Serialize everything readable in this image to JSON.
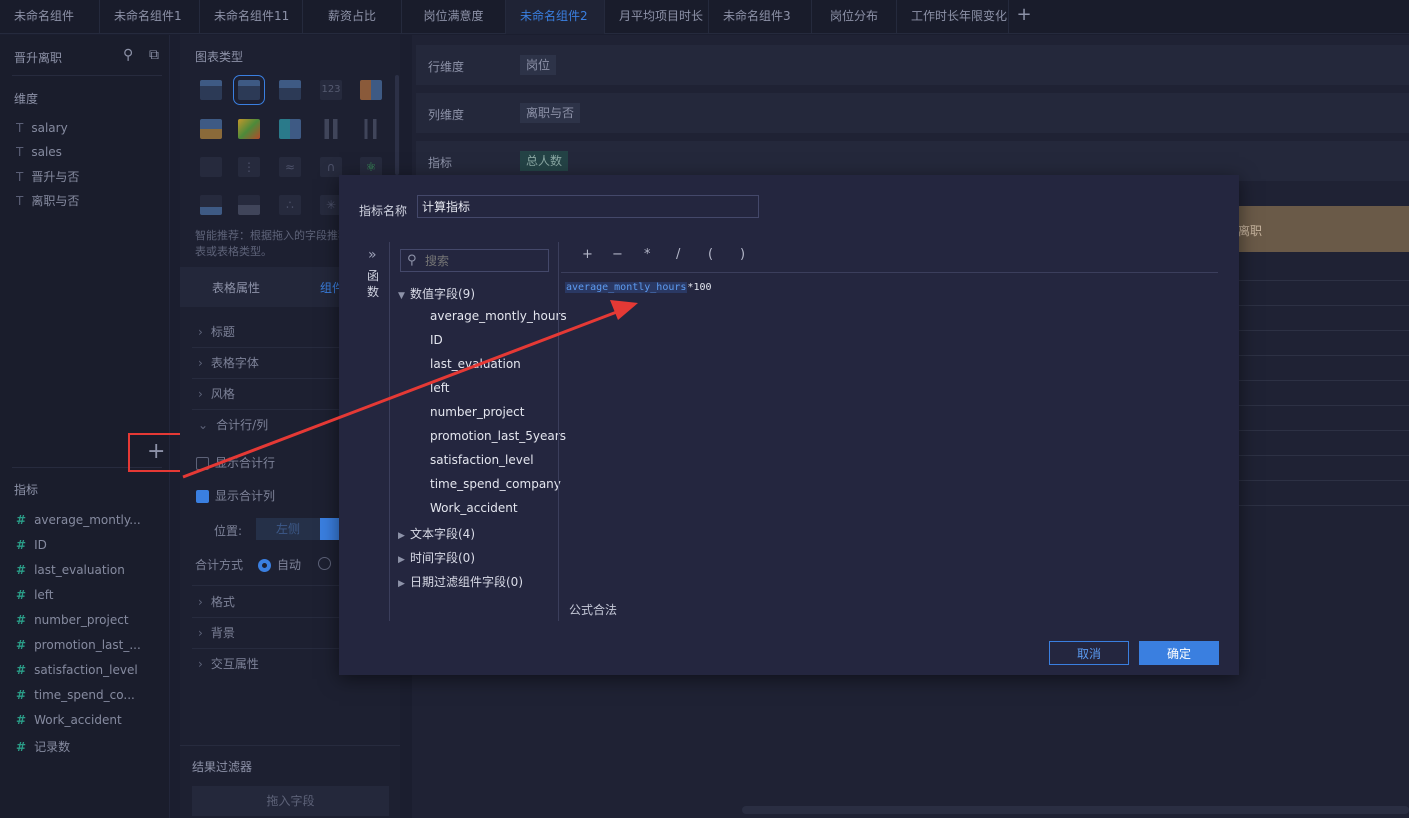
{
  "tabs": [
    "未命名组件",
    "未命名组件1",
    "未命名组件11",
    "薪资占比",
    "岗位满意度",
    "未命名组件2",
    "月平均项目时长",
    "未命名组件3",
    "岗位分布",
    "工作时长年限变化"
  ],
  "active_tab": "未命名组件2",
  "left_panel": {
    "dataset_name": "晋升离职",
    "dim_title": "维度",
    "dimensions": [
      "salary",
      "sales",
      "晋升与否",
      "离职与否"
    ],
    "mea_title": "指标",
    "measures": [
      "average_montly...",
      "ID",
      "last_evaluation",
      "left",
      "number_project",
      "promotion_last_...",
      "satisfaction_level",
      "time_spend_co...",
      "Work_accident",
      "记录数"
    ]
  },
  "mid_panel": {
    "chart_type_title": "图表类型",
    "hint": "智能推荐：根据拖入的字段推荐合适的图表或表格类型。",
    "tab_table": "表格属性",
    "tab_comp": "组件样式",
    "props": [
      "标题",
      "表格字体",
      "风格",
      "合计行/列"
    ],
    "show_total_row": "显示合计行",
    "show_total_col": "显示合计列",
    "position_label": "位置:",
    "position_left": "左侧",
    "total_mode_label": "合计方式",
    "total_auto": "自动",
    "props2": [
      "格式",
      "背景",
      "交互属性"
    ],
    "filter_title": "结果过滤器",
    "filter_drop": "拖入字段"
  },
  "right_panel": {
    "rows": [
      {
        "label": "行维度",
        "chip": "岗位"
      },
      {
        "label": "列维度",
        "chip": "离职与否"
      },
      {
        "label": "指标",
        "chip": "总人数"
      }
    ],
    "orange_text": "离职"
  },
  "modal": {
    "name_label": "指标名称",
    "name_value": "计算指标",
    "fn_label": "函数",
    "search_placeholder": "搜索",
    "groups": [
      {
        "label": "数值字段(9)",
        "expanded": true,
        "fields": [
          "average_montly_hours",
          "ID",
          "last_evaluation",
          "left",
          "number_project",
          "promotion_last_5years",
          "satisfaction_level",
          "time_spend_company",
          "Work_accident"
        ]
      },
      {
        "label": "文本字段(4)",
        "expanded": false
      },
      {
        "label": "时间字段(0)",
        "expanded": false
      },
      {
        "label": "日期过滤组件字段(0)",
        "expanded": false
      }
    ],
    "ops": [
      "+",
      "−",
      "*",
      "/",
      "(",
      ")"
    ],
    "formula_token": "average_montly_hours",
    "formula_rest": "*100",
    "valid_text": "公式合法",
    "cancel": "取消",
    "ok": "确定"
  },
  "colors": {
    "accent": "#3a7fe0",
    "annotation": "#e53935",
    "modal_bg": "#24263f"
  }
}
